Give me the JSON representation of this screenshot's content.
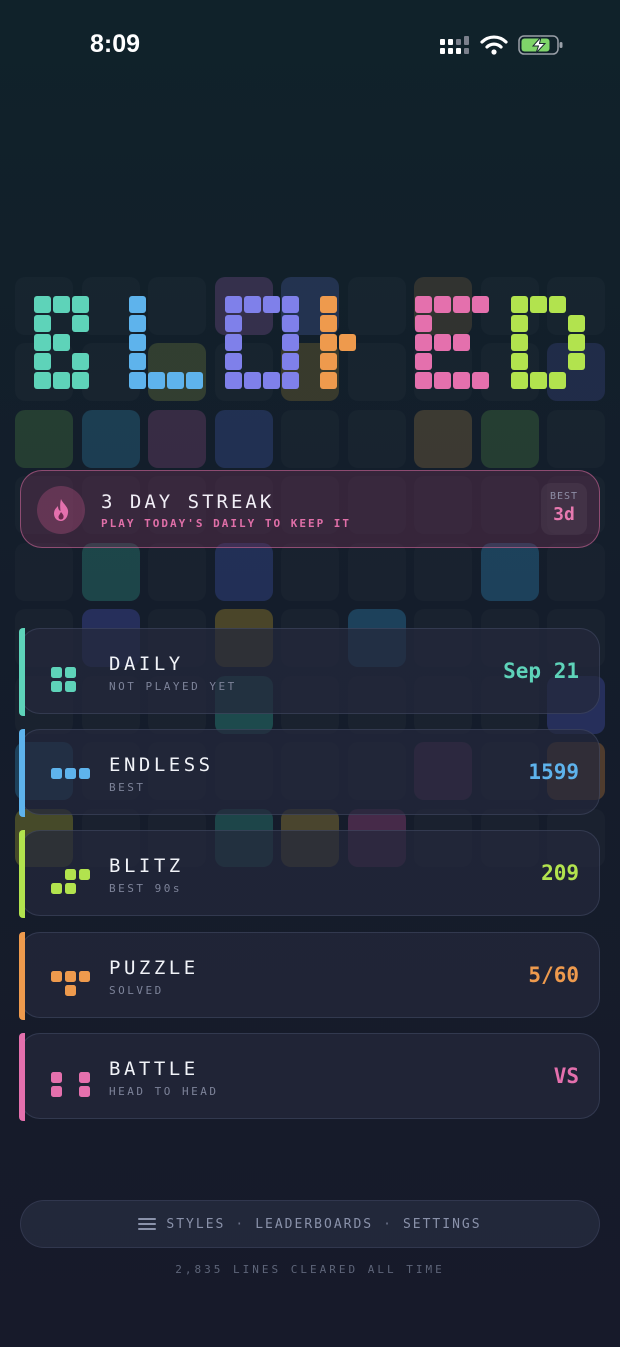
{
  "status_bar": {
    "time": "8:09"
  },
  "logo": {
    "text": "BLOCKED",
    "colors": [
      "#5ed3b9",
      "#5eb3ec",
      "#7f80ea",
      "#ee9a4d",
      "#e470ad",
      "#b2e34e"
    ]
  },
  "streak": {
    "title": "3 DAY STREAK",
    "subtitle": "PLAY TODAY'S DAILY TO KEEP IT",
    "best_label": "BEST",
    "best_value": "3d",
    "accent": "#e470ad",
    "icon": "flame-icon"
  },
  "modes": [
    {
      "name": "DAILY",
      "subtitle": "NOT PLAYED YET",
      "value": "Sep 21",
      "color": "#5ed3b9",
      "icon": "square-grid-icon"
    },
    {
      "name": "ENDLESS",
      "subtitle": "BEST",
      "value": "1599",
      "color": "#5eb3ec",
      "icon": "three-blocks-icon"
    },
    {
      "name": "BLITZ",
      "subtitle": "BEST 90s",
      "value": "209",
      "color": "#b2e34e",
      "icon": "s-block-icon"
    },
    {
      "name": "PUZZLE",
      "subtitle": "SOLVED",
      "value": "5/60",
      "color": "#ee9a4d",
      "icon": "t-block-icon"
    },
    {
      "name": "BATTLE",
      "subtitle": "HEAD TO HEAD",
      "value": "VS",
      "color": "#e470ad",
      "icon": "four-blocks-icon"
    }
  ],
  "footer": {
    "styles_label": "STYLES",
    "separator": "·",
    "leaderboards_label": "LEADERBOARDS",
    "settings_label": "SETTINGS",
    "icon": "menu-icon",
    "lines_cleared": "2,835 LINES CLEARED ALL TIME"
  }
}
